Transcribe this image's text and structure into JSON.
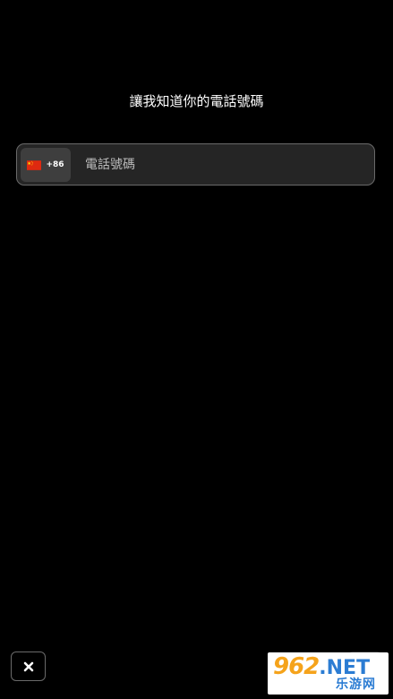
{
  "header": {
    "prompt": "讓我知道你的電話號碼"
  },
  "phone": {
    "country_code": "+86",
    "flag_icon": "china-flag-icon",
    "placeholder": "電話號碼",
    "value": ""
  },
  "footer": {
    "close_icon": "close-icon"
  },
  "watermark": {
    "numerals": "962",
    "domain": ".NET",
    "tagline": "乐游网"
  },
  "colors": {
    "background": "#000000",
    "field_background": "#252525",
    "field_border": "#6a6a6a",
    "code_background": "#3e3e3e",
    "flag_red": "#de2910",
    "flag_yellow": "#ffde00",
    "watermark_orange": "#f5a31b",
    "watermark_blue": "#2b7cd3"
  }
}
